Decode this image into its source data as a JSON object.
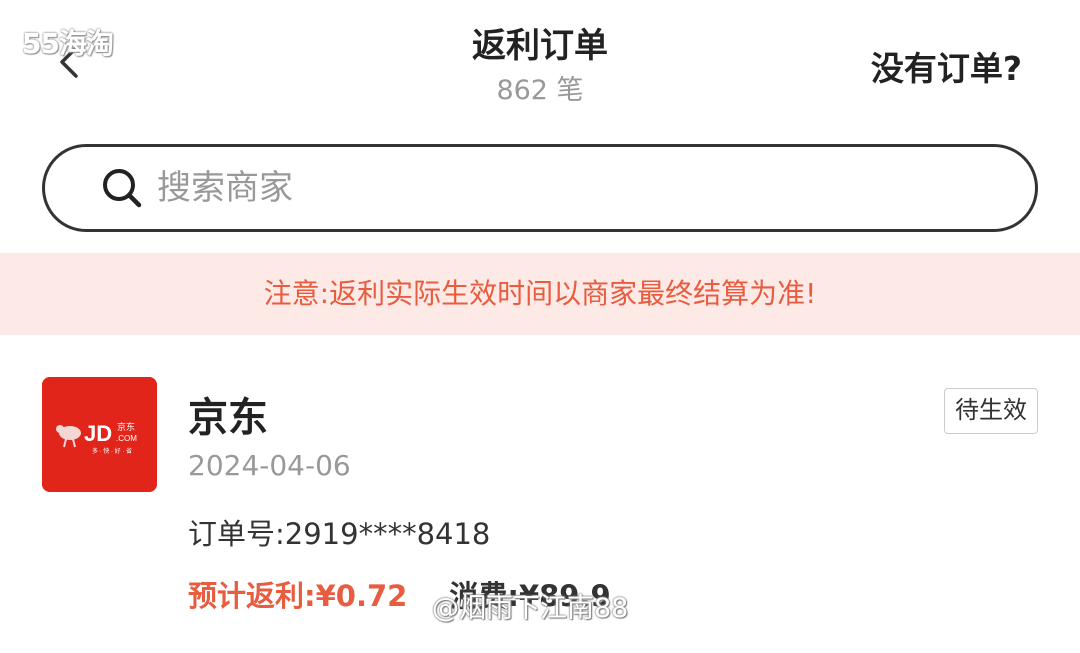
{
  "watermark_top": "55海淘",
  "watermark_bottom": "@烟雨下江南88",
  "header": {
    "title": "返利订单",
    "subtitle": "862 笔",
    "right_link": "没有订单?"
  },
  "search": {
    "placeholder": "搜索商家",
    "value": ""
  },
  "notice": "注意:返利实际生效时间以商家最终结算为准!",
  "order": {
    "logo_icon": "jd-logo-icon",
    "merchant": "京东",
    "status": "待生效",
    "date": "2024-04-06",
    "order_no_label": "订单号:",
    "order_no": "2919****8418",
    "rebate_label": "预计返利:",
    "rebate_value": "¥0.72",
    "spend_label": "消费:",
    "spend_value": "¥89.9"
  },
  "colors": {
    "accent": "#e85c3f",
    "notice_bg": "#fde9e5",
    "jd_red": "#e1251b"
  }
}
